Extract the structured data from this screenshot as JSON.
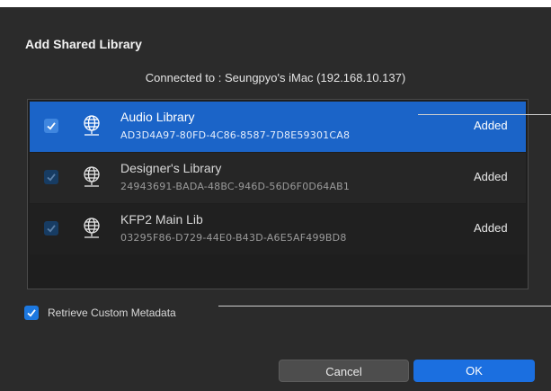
{
  "dialog": {
    "title": "Add Shared Library",
    "connected_text": "Connected to : Seungpyo's iMac (192.168.10.137)"
  },
  "libraries": [
    {
      "name": "Audio Library",
      "id": "AD3D4A97-80FD-4C86-8587-7D8E59301CA8",
      "status": "Added",
      "checked": true,
      "selected": true
    },
    {
      "name": "Designer's Library",
      "id": "24943691-BADA-48BC-946D-56D6F0D64AB1",
      "status": "Added",
      "checked": true,
      "selected": false
    },
    {
      "name": "KFP2 Main Lib",
      "id": "03295F86-D729-44E0-B43D-A6E5AF499BD8",
      "status": "Added",
      "checked": true,
      "selected": false
    }
  ],
  "options": {
    "retrieve_metadata_label": "Retrieve Custom Metadata",
    "retrieve_metadata_checked": true
  },
  "buttons": {
    "cancel": "Cancel",
    "ok": "OK"
  },
  "colors": {
    "selection": "#1b64c8",
    "dialog_bg": "#2b2b2b",
    "accent": "#1b6fe0"
  }
}
